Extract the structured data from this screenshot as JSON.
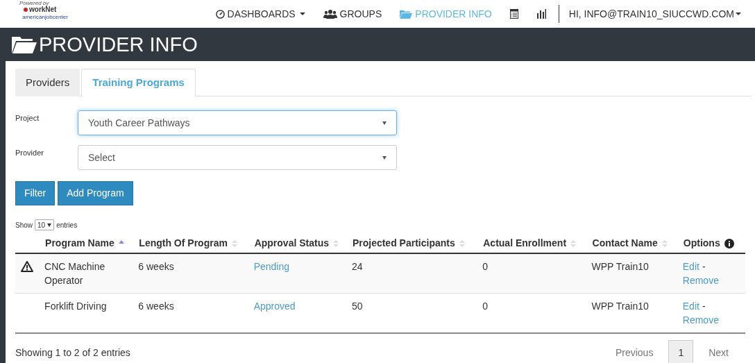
{
  "logo": {
    "texts": [
      "Powered by",
      "workNet",
      "americanjobcenter"
    ]
  },
  "nav": {
    "items": [
      {
        "label": "DASHBOARDS",
        "dropdown": true,
        "selected": false
      },
      {
        "label": "GROUPS",
        "dropdown": false,
        "selected": false
      },
      {
        "label": "PROVIDER INFO",
        "dropdown": false,
        "selected": true
      },
      {
        "dropdown": false,
        "selected": false
      },
      {
        "dropdown": false,
        "selected": false
      }
    ],
    "user": "HI, INFO@TRAIN10_SIUCCWD.COM"
  },
  "page_title": "PROVIDER INFO",
  "tabs": [
    {
      "label": "Providers",
      "selected": false
    },
    {
      "label": "Training Programs",
      "selected": true
    }
  ],
  "filters": [
    {
      "label": "Project",
      "value": "Youth Career Pathways",
      "focused": true
    },
    {
      "label": "Provider",
      "value": "Select",
      "focused": false
    }
  ],
  "buttons": [
    "Filter",
    "Add Program"
  ],
  "length_menu": {
    "before": "Show",
    "value": "10",
    "after": "entries"
  },
  "table": {
    "columns": [
      {
        "label": "Program Name",
        "kind": "sortable",
        "sorted": true
      },
      {
        "label": "Length Of Program",
        "kind": "sortable",
        "sorted": false
      },
      {
        "label": "Approval Status",
        "kind": "sortable",
        "sorted": false
      },
      {
        "label": "Projected Participants",
        "kind": "sortable",
        "sorted": false
      },
      {
        "label": "Actual Enrollment",
        "kind": "sortable",
        "sorted": false
      },
      {
        "label": "Contact Name",
        "kind": "sortable",
        "sorted": false
      },
      {
        "label": "Options",
        "kind": "info"
      }
    ],
    "rows": [
      {
        "warning": true,
        "cells": [
          "CNC Machine Operator",
          "6 weeks",
          "Pending",
          "24",
          "0",
          "WPP Train10"
        ],
        "actions": [
          "Edit",
          "-",
          "Remove"
        ]
      },
      {
        "warning": false,
        "cells": [
          "Forklift Driving",
          "6 weeks",
          "Approved",
          "50",
          "0",
          "WPP Train10"
        ],
        "actions": [
          "Edit",
          "-",
          "Remove"
        ]
      }
    ]
  },
  "info": "Showing 1 to 2 of 2 entries",
  "pagination": [
    {
      "label": "Previous",
      "selected": false
    },
    {
      "label": "1",
      "selected": true
    },
    {
      "label": "Next",
      "selected": false
    }
  ]
}
